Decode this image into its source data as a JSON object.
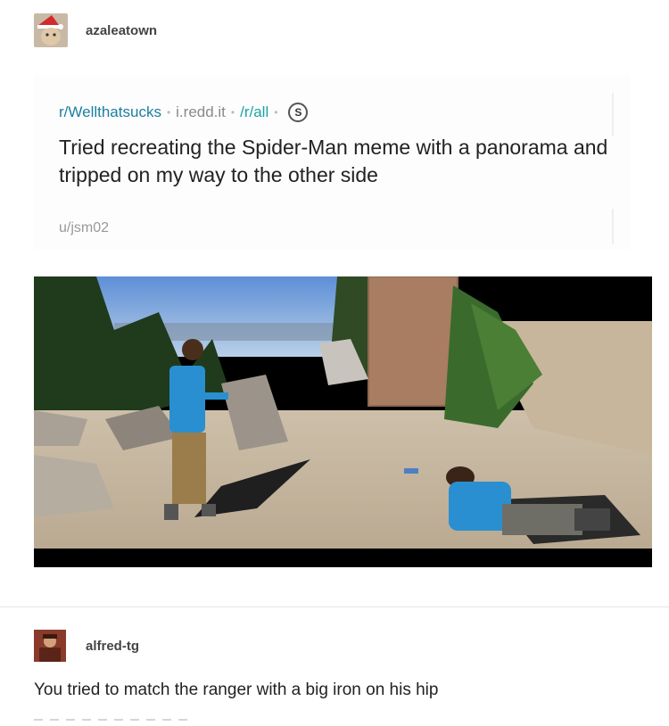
{
  "post": {
    "username": "azaleatown"
  },
  "reddit": {
    "subreddit": "r/Wellthatsucks",
    "domain": "i.redd.it",
    "all_link": "/r/all",
    "coin": "S",
    "title": "Tried recreating the Spider-Man meme with a panorama and tripped on my way to the other side",
    "author": "u/jsm02"
  },
  "reply": {
    "username": "alfred-tg",
    "text": "You tried to match the ranger with a big iron on his hip"
  },
  "colors": {
    "link_blue": "#1a7fa0",
    "link_teal": "#1aa3a3",
    "muted": "#8a8a8a"
  }
}
